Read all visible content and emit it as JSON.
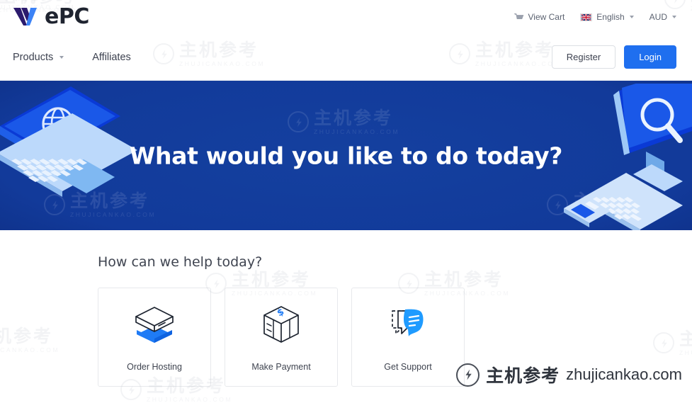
{
  "brand": {
    "logo_text": "ePC",
    "logo_mark": "w-logo-icon",
    "logo_purple": "#2b1a6d",
    "logo_blue": "#3b82f6",
    "logo_dark": "#1f2430"
  },
  "topbar": {
    "cart": {
      "label": "View Cart",
      "icon": "cart-icon"
    },
    "language": {
      "label": "English",
      "icon": "uk-flag-icon",
      "caret": "chevron-down-icon"
    },
    "currency": {
      "label": "AUD",
      "caret": "chevron-down-icon"
    }
  },
  "mainnav": {
    "links": [
      {
        "label": "Products",
        "has_caret": true
      },
      {
        "label": "Affiliates",
        "has_caret": false
      }
    ],
    "register_label": "Register",
    "login_label": "Login",
    "login_color": "#1f6fef"
  },
  "hero": {
    "title": "What would you like to do today?",
    "bg_color": "#123a9a",
    "left_art": "isometric-laptop-globe-illustration",
    "right_art": "isometric-desktop-search-illustration"
  },
  "help": {
    "title": "How can we help today?",
    "cards": [
      {
        "label": "Order Hosting",
        "icon": "server-stack-icon"
      },
      {
        "label": "Make Payment",
        "icon": "money-box-icon"
      },
      {
        "label": "Get Support",
        "icon": "chat-bubbles-icon"
      }
    ]
  },
  "watermark": {
    "cn": "主机参考",
    "en": "ZHUJICANKAO.COM",
    "brand_cn": "主机参考",
    "brand_domain": "zhujicankao.com",
    "logo": "zhujicankao-logo-icon"
  }
}
